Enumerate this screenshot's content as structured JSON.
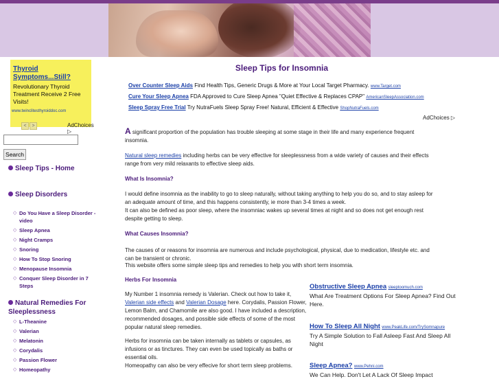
{
  "header": {
    "image_alt": "woman sleeping"
  },
  "sidebar": {
    "ad": {
      "title": "Thyroid Symptoms...Still?",
      "body": "Revolutionary Thyroid Treatment Receive 2 Free Visits!",
      "url": "www.twinclitesthyroiddoc.com",
      "prev": "<",
      "next": ">",
      "adchoices": "AdChoices ▷"
    },
    "search": {
      "button": "Search",
      "placeholder": ""
    },
    "nav": [
      {
        "label": "Sleep Tips - Home"
      },
      {
        "label": "Sleep Disorders"
      }
    ],
    "disorders": [
      {
        "label": "Do You Have a Sleep Disorder - video"
      },
      {
        "label": "Sleep Apnea"
      },
      {
        "label": "Night Cramps"
      },
      {
        "label": "Snoring"
      },
      {
        "label": "How To Stop Snoring"
      },
      {
        "label": "Menopause Insomnia"
      },
      {
        "label": "Conquer Sleep Disorder in 7 Steps"
      }
    ],
    "remedies_head": "Natural Remedies For Sleeplessness",
    "remedies": [
      {
        "label": "L-Theanine"
      },
      {
        "label": "Valerian"
      },
      {
        "label": "Melatonin"
      },
      {
        "label": "Corydalis"
      },
      {
        "label": "Passion Flower"
      },
      {
        "label": "Homeopathy"
      }
    ]
  },
  "main": {
    "title": "Sleep Tips for Insomnia",
    "sponsored": [
      {
        "title": "Over Counter Sleep Aids",
        "text": "Find Health Tips, Generic Drugs & More at Your Local Target Pharmacy.",
        "url": "www.Target.com"
      },
      {
        "title": "Cure Your Sleep Apnea",
        "text": "FDA Approved to Cure Sleep Apnea \"Quiet Effective & Replaces CPAP\"",
        "url": "AmericanSleepAssociation.com"
      },
      {
        "title": "Sleep Spray Free Trial",
        "text": "Try NutraFuels Sleep Spray Free! Natural, Efficient & Effective",
        "url": "ShopNutraFuels.com"
      }
    ],
    "adchoices": "AdChoices ▷",
    "intro_cap": "A",
    "intro": " significant proportion of the population has trouble sleeping at some stage in their life and many experience frequent insomnia.",
    "remedies_link": "Natural sleep remedies",
    "remedies_text": " including herbs can be very effective for sleeplessness from a wide variety of causes and their effects range from very mild relaxants to effective sleep aids.",
    "what_head": "What Is Insomnia?",
    "what_text1": "I would define insomnia as the inability to go to sleep naturally, without taking anything to help you do so, and to stay asleep for an adequate amount of time, and this happens consistently, ie more than 3-4 times a week.",
    "what_text2": "It can also be defined as poor sleep, where the insomniac wakes up several times at night and so does not get enough rest despite getting to sleep.",
    "causes_head": "What Causes Insomnia?",
    "causes_text1": "The causes of or reasons for insomnia are numerous and include psychological, physical, due to medication, lifestyle etc. and can be transient or chronic.",
    "causes_text2": "This website offers some simple sleep tips and remedies to help you with short term insomnia.",
    "herbs_head": "Herbs For Insomnia",
    "herbs_p1a": "My Number 1 insomnia remedy is Valerian. Check out how to take it, ",
    "herbs_link1": "Valerian side effects",
    "herbs_p1b": " and ",
    "herbs_link2": "Valerian Dosage",
    "herbs_p1c": " here. Corydalis, Passion Flower, Lemon Balm, and Chamomile are also good. I have included a description, recommended dosages, and possible side effects of some of the most popular natural sleep remedies.",
    "herbs_p2": "Herbs for insomnia can be taken internally as tablets or capsules, as infusions or as tinctures. They can even be used topically as baths or essential oils.",
    "herbs_p3": "Homeopathy can also be very effecive for short term sleep problems.",
    "right_ads": [
      {
        "title": "Obstructive Sleep Apnea",
        "url": "sleeptoomuch.com",
        "text": "What Are Treatment Options For Sleep Apnea? Find Out Here."
      },
      {
        "title": "How To Sleep All Night",
        "url": "www.PeakLife.com/TrySomnapure",
        "text": "Try A Simple Solution to Fall Asleep Fast And Sleep All Night"
      },
      {
        "title": "Sleep Apnea?",
        "url": "www.Pehni.com",
        "text": "We Can Help. Don't Let A Lack Of Sleep Impact"
      }
    ]
  }
}
